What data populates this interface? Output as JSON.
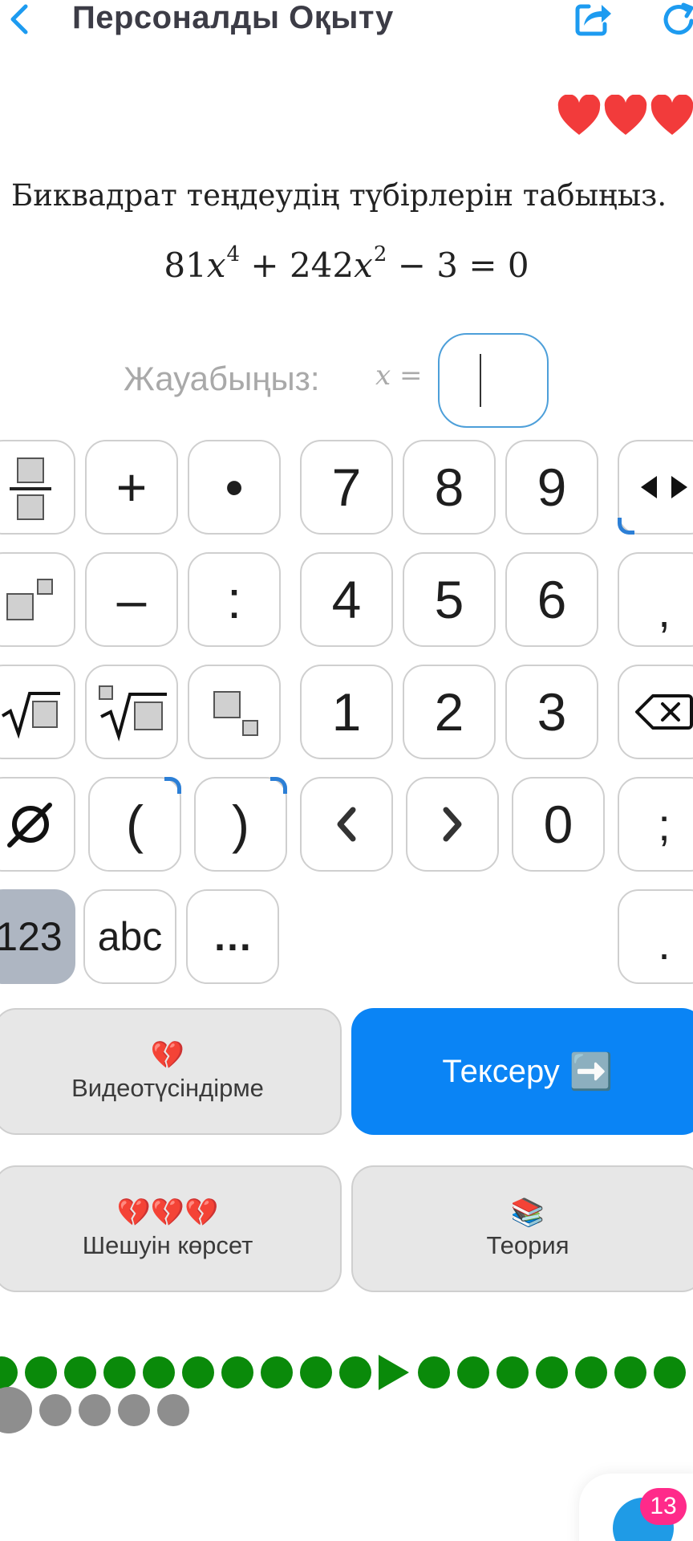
{
  "header": {
    "title": "Персоналды Оқыту",
    "back_icon": "chevron-left-icon",
    "share_icon": "share-icon",
    "refresh_icon": "refresh-icon"
  },
  "hearts": {
    "count": 3,
    "color": "#f23b3b"
  },
  "task": {
    "text": "Биквадрат теңдеудің түбірлерін табыңыз.",
    "equation": {
      "a": "81",
      "var": "x",
      "p1": "4",
      "b": "+ 242",
      "p2": "2",
      "rest": "− 3 = 0"
    }
  },
  "answer": {
    "label": "Жауабыңыз:",
    "var": "x",
    "eq": "=",
    "value": ""
  },
  "keyboard": {
    "plus": "+",
    "dot": "•",
    "minus": "–",
    "colon": ":",
    "d7": "7",
    "d8": "8",
    "d9": "9",
    "d4": "4",
    "d5": "5",
    "d6": "6",
    "d1": "1",
    "d2": "2",
    "d3": "3",
    "d0": "0",
    "comma": ",",
    "semicolon": ";",
    "period": ".",
    "open_paren": "(",
    "close_paren": ")",
    "empty_set": "∅",
    "mode_123": "123",
    "mode_abc": "abc",
    "more": "…"
  },
  "actions": {
    "video": {
      "label": "Видеотүсіндірме",
      "cost": "💔"
    },
    "check": {
      "label": "Тексеру",
      "icon": "➡️"
    },
    "solution": {
      "label": "Шешуін көрсет",
      "cost": "💔💔💔"
    },
    "theory": {
      "label": "Теория",
      "icon": "📚"
    }
  },
  "progress": {
    "done_before": 10,
    "done_after": 7,
    "remaining": 5
  },
  "chat": {
    "badge": "13",
    "icon": "chat-icon"
  },
  "colors": {
    "accent": "#0a84f5",
    "success": "#0a8a0a",
    "badge": "#ff2a8a"
  }
}
